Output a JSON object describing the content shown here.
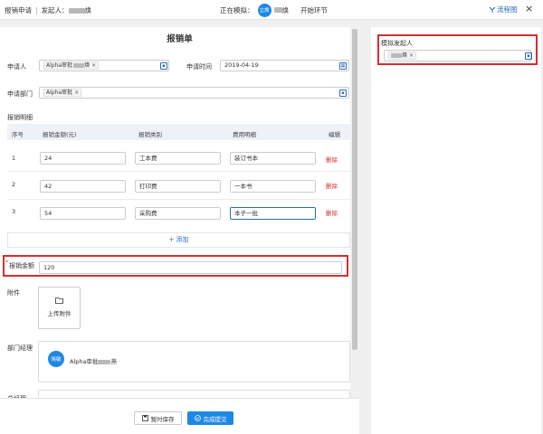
{
  "header": {
    "title": "报销申请",
    "separator": "|",
    "initiator_label": "发起人：",
    "initiator_name_suffix": "焕",
    "simulating_label": "正在模拟：",
    "sim_avatar": "立焕",
    "sim_name_suffix": "焕",
    "start_node": "开始环节",
    "flowchart_label": "流程图",
    "close_glyph": "×"
  },
  "right": {
    "sim_label": "模拟发起人",
    "sim_tag_suffix": "焕",
    "tag_close": "×"
  },
  "form": {
    "title": "报销单",
    "applicant_label": "申请人",
    "applicant_tag": "Alpha审批",
    "applicant_tag_suffix": "焕",
    "date_label": "申请时间",
    "date_value": "2019-04-19",
    "dept_label": "申请部门",
    "dept_tag": "Alpha审批",
    "tag_close": "×",
    "detail_label": "报销明细",
    "columns": [
      "序号",
      "报销金额(元)",
      "报销类别",
      "费用明细",
      "编辑"
    ],
    "rows": [
      {
        "no": "1",
        "amount": "24",
        "category": "工本费",
        "detail": "装订书本",
        "action": "删除"
      },
      {
        "no": "2",
        "amount": "42",
        "category": "打印费",
        "detail": "一本书",
        "action": "删除"
      },
      {
        "no": "3",
        "amount": "54",
        "category": "采购费",
        "detail": "本子一批",
        "action": "删除"
      }
    ],
    "add_label": "+ 添加",
    "total_star": "*",
    "total_label": "报销金额",
    "total_value": "120",
    "attach_label": "附件",
    "upload_label": "上传附件",
    "manager_label": "部门经理",
    "manager_avatar": "晓敏",
    "manager_name": "Alpha审批",
    "manager_name_suffix": "燕",
    "next_label": "总经理"
  },
  "footer": {
    "save_label": "暂时保存",
    "submit_label": "完成提交"
  },
  "colors": {
    "accent": "#1e88e5",
    "highlight": "#d32f2f",
    "link": "#2b6cb8"
  }
}
